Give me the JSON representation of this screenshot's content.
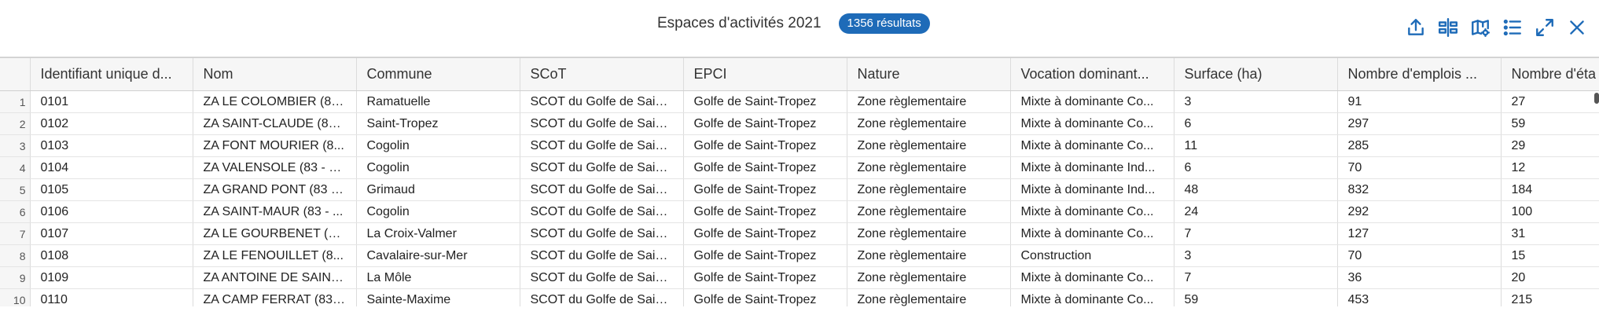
{
  "header": {
    "title": "Espaces d'activités 2021",
    "results_badge": "1356 résultats",
    "tools": [
      {
        "name": "export-icon"
      },
      {
        "name": "columns-icon"
      },
      {
        "name": "map-settings-icon"
      },
      {
        "name": "list-icon"
      },
      {
        "name": "fullscreen-icon"
      },
      {
        "name": "close-icon"
      }
    ]
  },
  "table": {
    "columns": [
      "Identifiant unique d...",
      "Nom",
      "Commune",
      "SCoT",
      "EPCI",
      "Nature",
      "Vocation dominant...",
      "Surface (ha)",
      "Nombre d'emplois ...",
      "Nombre d'éta"
    ],
    "rows": [
      {
        "n": "1",
        "cells": [
          "0101",
          "ZA LE COLOMBIER (83...",
          "Ramatuelle",
          "SCOT du Golfe de Sain...",
          "Golfe de Saint-Tropez",
          "Zone règlementaire",
          "Mixte à dominante Co...",
          "3",
          "91",
          "27"
        ]
      },
      {
        "n": "2",
        "cells": [
          "0102",
          "ZA SAINT-CLAUDE (83...",
          "Saint-Tropez",
          "SCOT du Golfe de Sain...",
          "Golfe de Saint-Tropez",
          "Zone règlementaire",
          "Mixte à dominante Co...",
          "6",
          "297",
          "59"
        ]
      },
      {
        "n": "3",
        "cells": [
          "0103",
          "ZA FONT MOURIER (8...",
          "Cogolin",
          "SCOT du Golfe de Sain...",
          "Golfe de Saint-Tropez",
          "Zone règlementaire",
          "Mixte à dominante Co...",
          "11",
          "285",
          "29"
        ]
      },
      {
        "n": "4",
        "cells": [
          "0104",
          "ZA VALENSOLE (83 - C...",
          "Cogolin",
          "SCOT du Golfe de Sain...",
          "Golfe de Saint-Tropez",
          "Zone règlementaire",
          "Mixte à dominante Ind...",
          "6",
          "70",
          "12"
        ]
      },
      {
        "n": "5",
        "cells": [
          "0105",
          "ZA GRAND PONT (83 -...",
          "Grimaud",
          "SCOT du Golfe de Sain...",
          "Golfe de Saint-Tropez",
          "Zone règlementaire",
          "Mixte à dominante Ind...",
          "48",
          "832",
          "184"
        ]
      },
      {
        "n": "6",
        "cells": [
          "0106",
          "ZA SAINT-MAUR (83 - ...",
          "Cogolin",
          "SCOT du Golfe de Sain...",
          "Golfe de Saint-Tropez",
          "Zone règlementaire",
          "Mixte à dominante Co...",
          "24",
          "292",
          "100"
        ]
      },
      {
        "n": "7",
        "cells": [
          "0107",
          "ZA LE GOURBENET (8...",
          "La Croix-Valmer",
          "SCOT du Golfe de Sain...",
          "Golfe de Saint-Tropez",
          "Zone règlementaire",
          "Mixte à dominante Co...",
          "7",
          "127",
          "31"
        ]
      },
      {
        "n": "8",
        "cells": [
          "0108",
          "ZA LE FENOUILLET (8...",
          "Cavalaire-sur-Mer",
          "SCOT du Golfe de Sain...",
          "Golfe de Saint-Tropez",
          "Zone règlementaire",
          "Construction",
          "3",
          "70",
          "15"
        ]
      },
      {
        "n": "9",
        "cells": [
          "0109",
          "ZA ANTOINE DE SAINT...",
          "La Môle",
          "SCOT du Golfe de Sain...",
          "Golfe de Saint-Tropez",
          "Zone règlementaire",
          "Mixte à dominante Co...",
          "7",
          "36",
          "20"
        ]
      },
      {
        "n": "10",
        "cells": [
          "0110",
          "ZA CAMP FERRAT (83 ...",
          "Sainte-Maxime",
          "SCOT du Golfe de Sain...",
          "Golfe de Saint-Tropez",
          "Zone règlementaire",
          "Mixte à dominante Co...",
          "59",
          "453",
          "215"
        ]
      }
    ]
  },
  "colors": {
    "accent": "#1e6bb8"
  }
}
